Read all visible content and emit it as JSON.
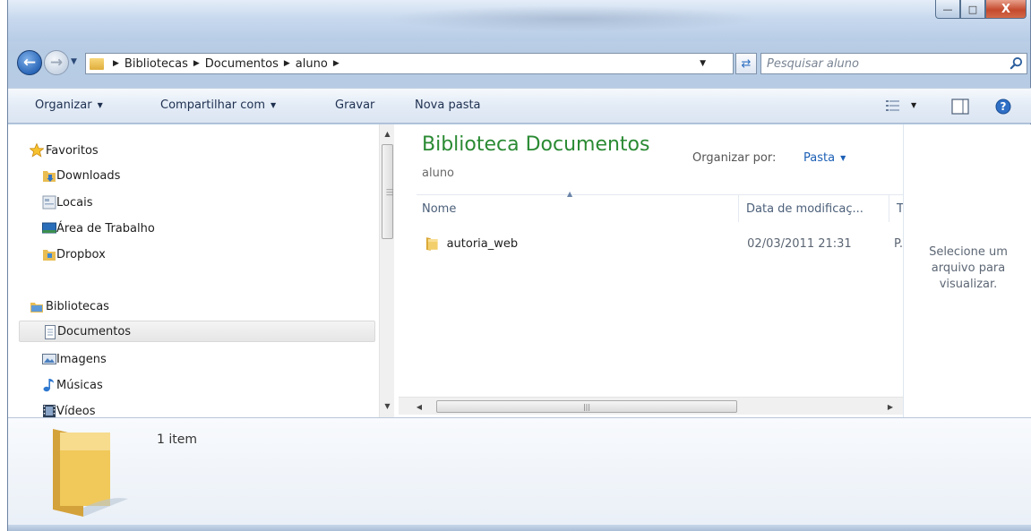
{
  "window": {
    "caption_buttons": [
      "minimize",
      "maximize",
      "close"
    ]
  },
  "address_bar": {
    "breadcrumbs": [
      "Bibliotecas",
      "Documentos",
      "aluno"
    ],
    "search_placeholder": "Pesquisar aluno"
  },
  "toolbar": {
    "organize": "Organizar",
    "share": "Compartilhar com",
    "burn": "Gravar",
    "new_folder": "Nova pasta"
  },
  "nav_pane": {
    "favorites_label": "Favoritos",
    "favorites": [
      "Downloads",
      "Locais",
      "Área de Trabalho",
      "Dropbox"
    ],
    "libraries_label": "Bibliotecas",
    "libraries": [
      "Documentos",
      "Imagens",
      "Músicas",
      "Vídeos"
    ],
    "selected": "Documentos"
  },
  "library": {
    "title": "Biblioteca Documentos",
    "subtitle": "aluno",
    "arrange_by_label": "Organizar por:",
    "arrange_by_value": "Pasta"
  },
  "columns": {
    "name": "Nome",
    "date": "Data de modificaç...",
    "type": "Ti"
  },
  "files": [
    {
      "name": "autoria_web",
      "date": "02/03/2011 21:31",
      "type": "P."
    }
  ],
  "preview": {
    "message": "Selecione um arquivo para visualizar."
  },
  "details": {
    "count": "1 item"
  },
  "colors": {
    "library_title": "#2a8a33",
    "link_blue": "#1c5fb5",
    "close_button": "#c44a2e"
  }
}
